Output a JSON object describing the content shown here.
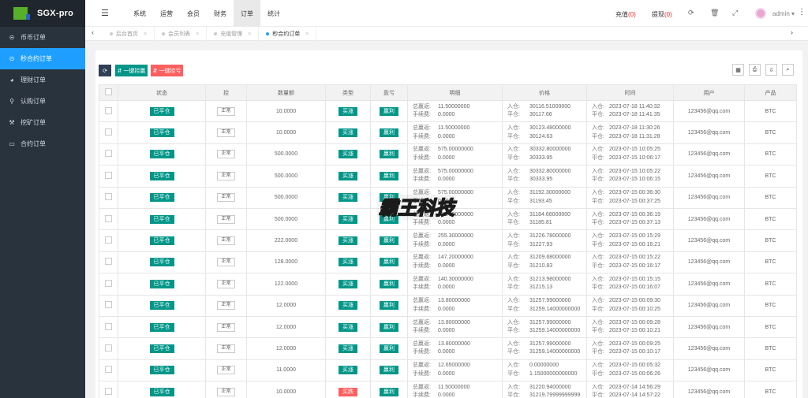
{
  "app": {
    "name": "SGX-pro"
  },
  "sidebar": {
    "items": [
      {
        "label": "币币订单",
        "icon": "coin-icon",
        "glyph": "⊝"
      },
      {
        "label": "秒合约订单",
        "icon": "clock-icon",
        "glyph": "⊙"
      },
      {
        "label": "理财订单",
        "icon": "finance-icon",
        "glyph": "◕"
      },
      {
        "label": "认购订单",
        "icon": "subscribe-icon",
        "glyph": "⚲"
      },
      {
        "label": "挖矿订单",
        "icon": "mining-icon",
        "glyph": "⚒"
      },
      {
        "label": "合约订单",
        "icon": "monitor-icon",
        "glyph": "▭"
      }
    ]
  },
  "topnav": {
    "items": [
      "系统",
      "运营",
      "会员",
      "财务",
      "订单",
      "统计"
    ],
    "recharge": {
      "label": "充值",
      "count": "(0)"
    },
    "withdraw": {
      "label": "提现",
      "count": "(0)"
    },
    "user": "admin"
  },
  "tabs": [
    {
      "label": "后台首页"
    },
    {
      "label": "会员列表"
    },
    {
      "label": "充值管理"
    },
    {
      "label": "秒合约订单"
    }
  ],
  "toolbar": {
    "btn_profit": "⇵ 一键控赢",
    "btn_loss": "⇵ 一键控亏"
  },
  "table": {
    "headers": [
      "状态",
      "控",
      "数量额",
      "类型",
      "盈亏",
      "明细",
      "价格",
      "时间",
      "用户",
      "产品"
    ],
    "detail_labels": [
      "总赢返:",
      "手续费:"
    ],
    "price_labels": [
      "入仓:",
      "平仓:"
    ],
    "time_labels": [
      "入仓:",
      "平仓:"
    ],
    "rows": [
      {
        "status": "已平仓",
        "ctrl": "正常",
        "amount": "10.0000",
        "type": "买涨",
        "pnl": "赢利",
        "ret": "11.50000000",
        "fee": "0.0000",
        "p_in": "30116.51000000",
        "p_out": "30117.66",
        "t_in": "2023-07-18 11:40:32",
        "t_out": "2023-07-18 11:41:35",
        "user": "123456@qq.com",
        "product": "BTC"
      },
      {
        "status": "已平仓",
        "ctrl": "正常",
        "amount": "10.0000",
        "type": "买涨",
        "pnl": "赢利",
        "ret": "11.50000000",
        "fee": "0.0000",
        "p_in": "30123.48000000",
        "p_out": "30124.63",
        "t_in": "2023-07-18 11:30:26",
        "t_out": "2023-07-18 11:31:28",
        "user": "123456@qq.com",
        "product": "BTC"
      },
      {
        "status": "已平仓",
        "ctrl": "正常",
        "amount": "500.0000",
        "type": "买涨",
        "pnl": "赢利",
        "ret": "575.00000000",
        "fee": "0.0000",
        "p_in": "30332.80000000",
        "p_out": "30333.95",
        "t_in": "2023-07-15 10:05:25",
        "t_out": "2023-07-15 10:06:17",
        "user": "123456@qq.com",
        "product": "BTC"
      },
      {
        "status": "已平仓",
        "ctrl": "正常",
        "amount": "500.0000",
        "type": "买涨",
        "pnl": "赢利",
        "ret": "575.00000000",
        "fee": "0.0000",
        "p_in": "30332.80000000",
        "p_out": "30333.95",
        "t_in": "2023-07-15 10:05:22",
        "t_out": "2023-07-15 10:06:15",
        "user": "123456@qq.com",
        "product": "BTC"
      },
      {
        "status": "已平仓",
        "ctrl": "正常",
        "amount": "500.0000",
        "type": "买涨",
        "pnl": "赢利",
        "ret": "575.00000000",
        "fee": "0.0000",
        "p_in": "31192.30000000",
        "p_out": "31193.45",
        "t_in": "2023-07-15 00:36:30",
        "t_out": "2023-07-15 00:37:25",
        "user": "123456@qq.com",
        "product": "BTC"
      },
      {
        "status": "已平仓",
        "ctrl": "正常",
        "amount": "500.0000",
        "type": "买涨",
        "pnl": "赢利",
        "ret": "575.00000000",
        "fee": "0.0000",
        "p_in": "31184.66000000",
        "p_out": "31185.81",
        "t_in": "2023-07-15 00:36:19",
        "t_out": "2023-07-15 00:37:13",
        "user": "123456@qq.com",
        "product": "BTC"
      },
      {
        "status": "已平仓",
        "ctrl": "正常",
        "amount": "222.0000",
        "type": "买涨",
        "pnl": "赢利",
        "ret": "255.30000000",
        "fee": "0.0000",
        "p_in": "31226.78000000",
        "p_out": "31227.93",
        "t_in": "2023-07-15 00:15:29",
        "t_out": "2023-07-15 00:16:21",
        "user": "123456@qq.com",
        "product": "BTC"
      },
      {
        "status": "已平仓",
        "ctrl": "正常",
        "amount": "128.0000",
        "type": "买涨",
        "pnl": "赢利",
        "ret": "147.20000000",
        "fee": "0.0000",
        "p_in": "31209.68000000",
        "p_out": "31210.83",
        "t_in": "2023-07-15 00:15:22",
        "t_out": "2023-07-15 00:16:17",
        "user": "123456@qq.com",
        "product": "BTC"
      },
      {
        "status": "已平仓",
        "ctrl": "正常",
        "amount": "122.0000",
        "type": "买涨",
        "pnl": "赢利",
        "ret": "140.30000000",
        "fee": "0.0000",
        "p_in": "31213.98000000",
        "p_out": "31215.13",
        "t_in": "2023-07-15 00:15:15",
        "t_out": "2023-07-15 00:16:07",
        "user": "123456@qq.com",
        "product": "BTC"
      },
      {
        "status": "已平仓",
        "ctrl": "正常",
        "amount": "12.0000",
        "type": "买涨",
        "pnl": "赢利",
        "ret": "13.80000000",
        "fee": "0.0000",
        "p_in": "31257.99000000",
        "p_out": "31259.14000000000",
        "t_in": "2023-07-15 00:09:30",
        "t_out": "2023-07-15 00:10:25",
        "user": "123456@qq.com",
        "product": "BTC"
      },
      {
        "status": "已平仓",
        "ctrl": "正常",
        "amount": "12.0000",
        "type": "买涨",
        "pnl": "赢利",
        "ret": "13.80000000",
        "fee": "0.0000",
        "p_in": "31257.99000000",
        "p_out": "31259.14000000000",
        "t_in": "2023-07-15 00:09:28",
        "t_out": "2023-07-15 00:10:21",
        "user": "123456@qq.com",
        "product": "BTC"
      },
      {
        "status": "已平仓",
        "ctrl": "正常",
        "amount": "12.0000",
        "type": "买涨",
        "pnl": "赢利",
        "ret": "13.80000000",
        "fee": "0.0000",
        "p_in": "31257.99000000",
        "p_out": "31259.14000000000",
        "t_in": "2023-07-15 00:09:25",
        "t_out": "2023-07-15 00:10:17",
        "user": "123456@qq.com",
        "product": "BTC"
      },
      {
        "status": "已平仓",
        "ctrl": "正常",
        "amount": "11.0000",
        "type": "买涨",
        "pnl": "赢利",
        "ret": "12.65000000",
        "fee": "0.0000",
        "p_in": "0.00000000",
        "p_out": "1.15000000000000",
        "t_in": "2023-07-15 00:05:32",
        "t_out": "2023-07-15 00:06:26",
        "user": "123456@qq.com",
        "product": "BTC"
      },
      {
        "status": "已平仓",
        "ctrl": "正常",
        "amount": "10.0000",
        "type": "买跌",
        "pnl": "赢利",
        "ret": "11.50000000",
        "fee": "0.0000",
        "p_in": "31220.94000000",
        "p_out": "31219.79999999999",
        "t_in": "2023-07-14 14:56:29",
        "t_out": "2023-07-14 14:57:22",
        "user": "123456@qq.com",
        "product": "BTC"
      }
    ]
  },
  "watermark": "霸王科技",
  "colors": {
    "primary": "#1e9fff",
    "green": "#009688",
    "red": "#ff5f5f",
    "sidebar": "#28333e"
  }
}
